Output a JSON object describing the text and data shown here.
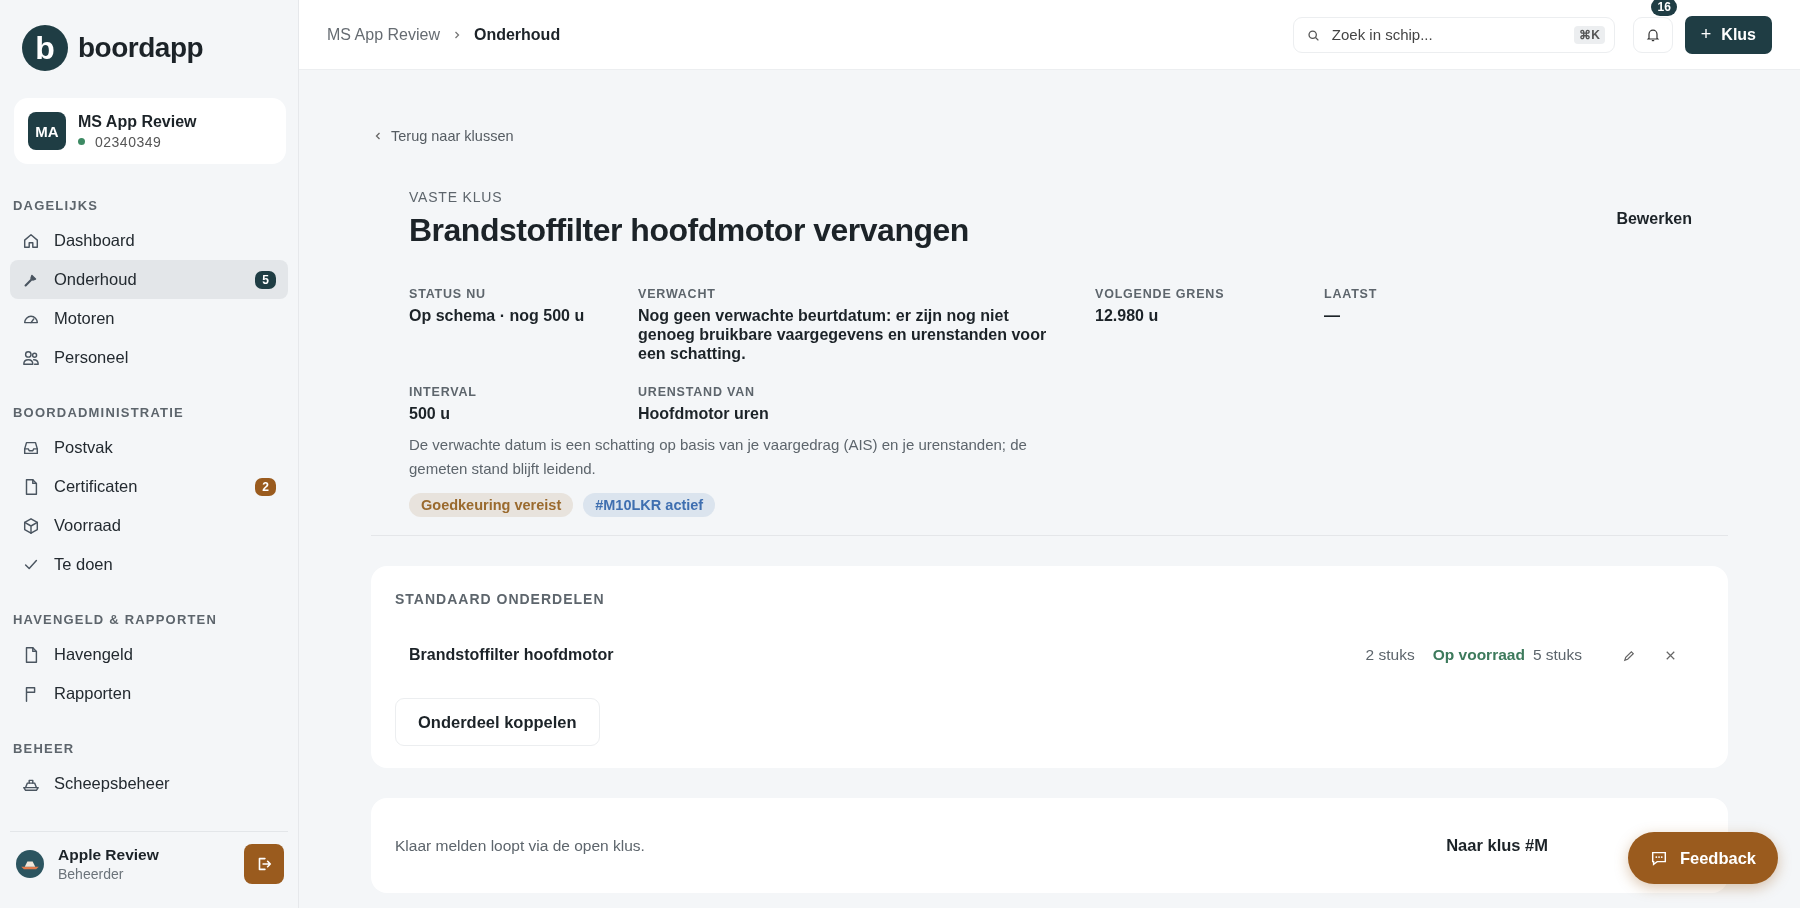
{
  "brand": {
    "logo_letter": "b",
    "name": "boordapp"
  },
  "ship": {
    "initials": "MA",
    "name": "MS App Review",
    "number": "02340349",
    "online": true
  },
  "sidebar": {
    "sections": [
      {
        "heading": "DAGELIJKS",
        "items": [
          {
            "label": "Dashboard",
            "selected": false
          },
          {
            "label": "Onderhoud",
            "selected": true,
            "badge": {
              "count": "5",
              "color": "#1f3d44"
            }
          },
          {
            "label": "Motoren",
            "selected": false
          },
          {
            "label": "Personeel",
            "selected": false
          }
        ]
      },
      {
        "heading": "BOORDADMINISTRATIE",
        "items": [
          {
            "label": "Postvak",
            "selected": false
          },
          {
            "label": "Certificaten",
            "selected": false,
            "badge": {
              "count": "2",
              "color": "#9a5b1e"
            }
          },
          {
            "label": "Voorraad",
            "selected": false
          },
          {
            "label": "Te doen",
            "selected": false
          }
        ]
      },
      {
        "heading": "HAVENGELD & RAPPORTEN",
        "items": [
          {
            "label": "Havengeld",
            "selected": false
          },
          {
            "label": "Rapporten",
            "selected": false
          }
        ]
      },
      {
        "heading": "BEHEER",
        "items": [
          {
            "label": "Scheepsbeheer",
            "selected": false
          }
        ]
      }
    ]
  },
  "user": {
    "name": "Apple Review",
    "role": "Beheerder"
  },
  "breadcrumb": [
    "MS App Review",
    "Onderhoud"
  ],
  "search": {
    "placeholder": "Zoek in schip...",
    "shortcut": "⌘K"
  },
  "notifications": {
    "count": "16"
  },
  "new_button": {
    "icon": "+",
    "label": "Klus"
  },
  "back_link": "Terug naar klussen",
  "job": {
    "kicker": "VASTE KLUS",
    "title": "Brandstoffilter hoofdmotor vervangen",
    "edit": "Bewerken",
    "facts": [
      {
        "label": "STATUS NU",
        "value": "Op schema · nog 500 u"
      },
      {
        "label": "VERWACHT",
        "value": "Nog geen verwachte beurtdatum: er zijn nog niet genoeg bruikbare vaargegevens en urenstanden voor een schatting."
      },
      {
        "label": "VOLGENDE GRENS",
        "value": "12.980 u"
      },
      {
        "label": "LAATST",
        "value": "—"
      },
      {
        "label": "INTERVAL",
        "value": "500 u"
      },
      {
        "label": "URENSTAND VAN",
        "value": "Hoofdmotor uren"
      }
    ],
    "note": "De verwachte datum is een schatting op basis van je vaargedrag (AIS) en je urenstanden; de gemeten stand blijft leidend.",
    "tags": [
      {
        "label": "Goedkeuring vereist",
        "color": "#9a6a2e"
      },
      {
        "label": "#M10LKR actief",
        "color": "#3f6fb0"
      }
    ]
  },
  "parts": {
    "heading": "STANDAARD ONDERDELEN",
    "rows": [
      {
        "name": "Brandstoffilter hoofdmotor",
        "quantity": "2 stuks",
        "stock_status": "Op voorraad",
        "stock": "5 stuks"
      }
    ],
    "link_button": "Onderdeel koppelen"
  },
  "completion": {
    "text": "Klaar melden loopt via de open klus.",
    "link": "Naar klus #M"
  },
  "feedback": {
    "label": "Feedback"
  }
}
